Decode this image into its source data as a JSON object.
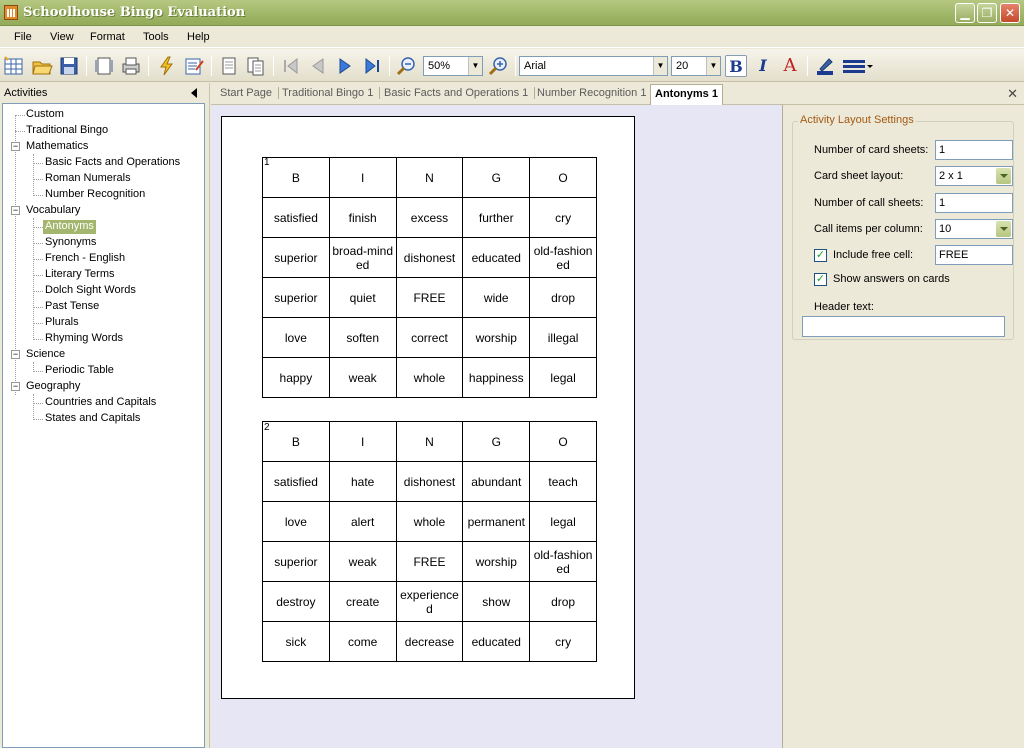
{
  "window": {
    "title": "Schoolhouse Bingo Evaluation"
  },
  "menu": [
    "File",
    "View",
    "Format",
    "Tools",
    "Help"
  ],
  "toolbar": {
    "zoom": "50%",
    "font": "Arial",
    "font_size": "20",
    "bold_label": "B",
    "italic_label": "I",
    "color_label": "A"
  },
  "left": {
    "header": "Activities",
    "tree": [
      {
        "label": "Custom"
      },
      {
        "label": "Traditional Bingo"
      },
      {
        "label": "Mathematics"
      },
      {
        "label": "Basic Facts and Operations"
      },
      {
        "label": "Roman Numerals"
      },
      {
        "label": "Number Recognition"
      },
      {
        "label": "Vocabulary"
      },
      {
        "label": "Antonyms",
        "selected": true
      },
      {
        "label": "Synonyms"
      },
      {
        "label": "French - English"
      },
      {
        "label": "Literary Terms"
      },
      {
        "label": "Dolch Sight Words"
      },
      {
        "label": "Past Tense"
      },
      {
        "label": "Plurals"
      },
      {
        "label": "Rhyming Words"
      },
      {
        "label": "Science"
      },
      {
        "label": "Periodic Table"
      },
      {
        "label": "Geography"
      },
      {
        "label": "Countries and Capitals"
      },
      {
        "label": "States and Capitals"
      }
    ]
  },
  "tabs": [
    "Start Page",
    "Traditional Bingo 1",
    "Basic Facts and Operations 1",
    "Number Recognition 1",
    "Antonyms 1"
  ],
  "active_tab": "Antonyms 1",
  "cards": [
    {
      "number": "1",
      "header": [
        "B",
        "I",
        "N",
        "G",
        "O"
      ],
      "rows": [
        [
          "satisfied",
          "finish",
          "excess",
          "further",
          "cry"
        ],
        [
          "superior",
          "broad-minded",
          "dishonest",
          "educated",
          "old-fashioned"
        ],
        [
          "superior",
          "quiet",
          "FREE",
          "wide",
          "drop"
        ],
        [
          "love",
          "soften",
          "correct",
          "worship",
          "illegal"
        ],
        [
          "happy",
          "weak",
          "whole",
          "happiness",
          "legal"
        ]
      ]
    },
    {
      "number": "2",
      "header": [
        "B",
        "I",
        "N",
        "G",
        "O"
      ],
      "rows": [
        [
          "satisfied",
          "hate",
          "dishonest",
          "abundant",
          "teach"
        ],
        [
          "love",
          "alert",
          "whole",
          "permanent",
          "legal"
        ],
        [
          "superior",
          "weak",
          "FREE",
          "worship",
          "old-fashioned"
        ],
        [
          "destroy",
          "create",
          "experienced",
          "show",
          "drop"
        ],
        [
          "sick",
          "come",
          "decrease",
          "educated",
          "cry"
        ]
      ]
    }
  ],
  "settings": {
    "group_title": "Activity Layout Settings",
    "card_sheets_label": "Number of card sheets:",
    "card_sheets_value": "1",
    "layout_label": "Card sheet layout:",
    "layout_value": "2 x 1",
    "call_sheets_label": "Number of call sheets:",
    "call_sheets_value": "1",
    "call_items_label": "Call items per column:",
    "call_items_value": "10",
    "free_cell_label": "Include free cell:",
    "free_cell_value": "FREE",
    "free_cell_checked": true,
    "show_answers_label": "Show answers on cards",
    "show_answers_checked": true,
    "header_text_label": "Header text:",
    "header_text_value": ""
  },
  "colors": {
    "accent": "#a4ba6c",
    "selection": "#a4b66e",
    "group_title": "#a45a12"
  }
}
